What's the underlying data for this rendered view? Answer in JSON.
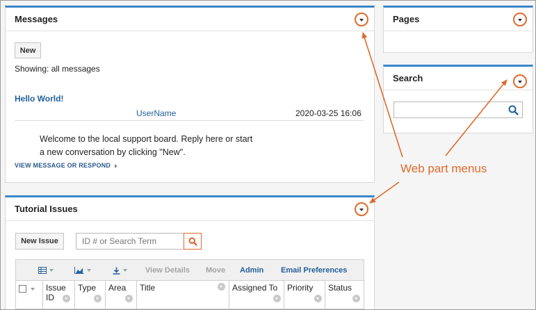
{
  "messages": {
    "title": "Messages",
    "new_label": "New",
    "showing": "Showing: all messages",
    "post": {
      "title": "Hello World!",
      "author": "UserName",
      "timestamp": "2020-03-25 16:06",
      "body_line1": "Welcome to the local support board. Reply here or start",
      "body_line2": "a new conversation by clicking \"New\".",
      "respond": "VIEW MESSAGE OR RESPOND"
    }
  },
  "pages": {
    "title": "Pages"
  },
  "search": {
    "title": "Search"
  },
  "issues": {
    "title": "Tutorial Issues",
    "new_issue_label": "New Issue",
    "search_placeholder": "ID # or Search Term",
    "toolbar": {
      "view_details": "View Details",
      "move": "Move",
      "admin": "Admin",
      "email_preferences": "Email Preferences"
    },
    "columns": [
      {
        "line1": "Issue",
        "line2": "ID"
      },
      {
        "line1": "Type",
        "line2": ""
      },
      {
        "line1": "Area",
        "line2": ""
      },
      {
        "line1": "Title",
        "line2": ""
      },
      {
        "line1": "Assigned To",
        "line2": ""
      },
      {
        "line1": "Priority",
        "line2": ""
      },
      {
        "line1": "Status",
        "line2": ""
      }
    ]
  },
  "annotation": {
    "label": "Web part menus",
    "color": "#e06a2c"
  },
  "colors": {
    "accent_bar": "#3a86c8",
    "link": "#22609a",
    "highlight": "#e06a2c"
  }
}
